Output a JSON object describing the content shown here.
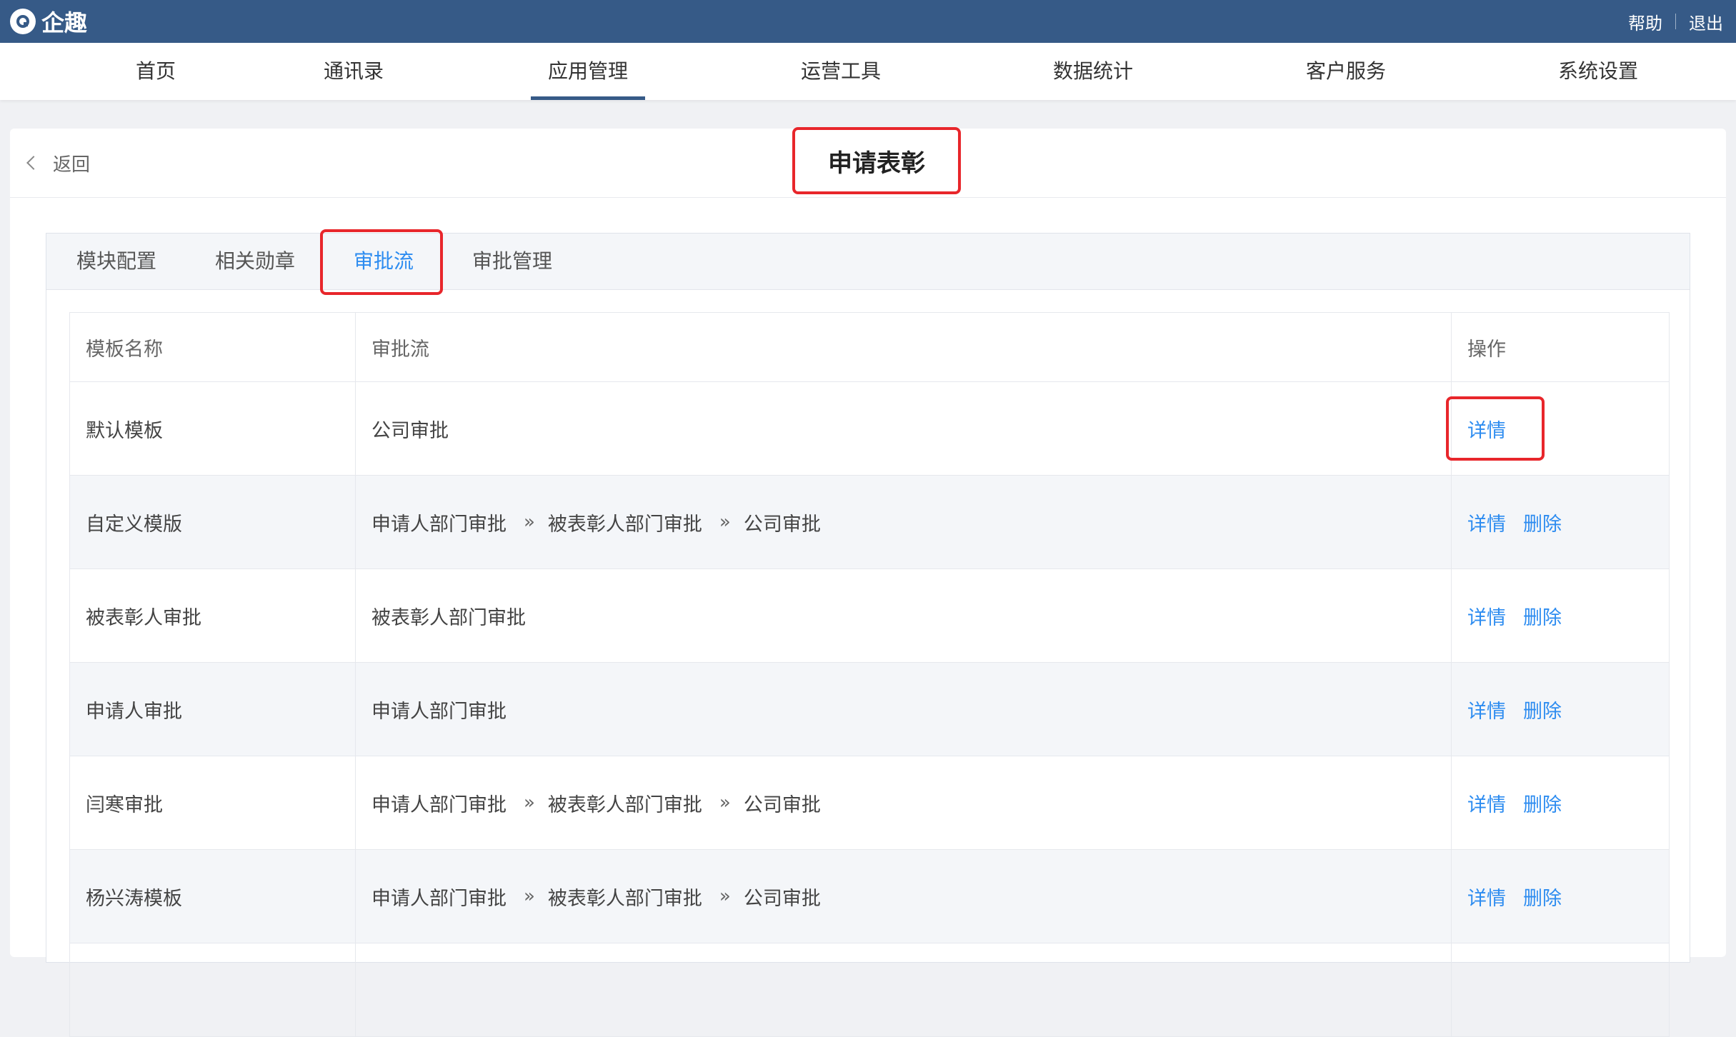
{
  "brand": {
    "logo_text": "企趣"
  },
  "top_links": {
    "help": "帮助",
    "logout": "退出"
  },
  "nav": [
    {
      "label": "首页"
    },
    {
      "label": "通讯录"
    },
    {
      "label": "应用管理",
      "active": true
    },
    {
      "label": "运营工具"
    },
    {
      "label": "数据统计"
    },
    {
      "label": "客户服务"
    },
    {
      "label": "系统设置"
    }
  ],
  "page": {
    "back_label": "返回",
    "title": "申请表彰"
  },
  "tabs": [
    {
      "label": "模块配置"
    },
    {
      "label": "相关勋章"
    },
    {
      "label": "审批流",
      "active": true
    },
    {
      "label": "审批管理"
    }
  ],
  "table": {
    "headers": {
      "name": "模板名称",
      "flow": "审批流",
      "action": "操作"
    },
    "rows": [
      {
        "name": "默认模板",
        "flow": [
          "公司审批"
        ],
        "actions": [
          "详情"
        ]
      },
      {
        "name": "自定义模版",
        "flow": [
          "申请人部门审批",
          "被表彰人部门审批",
          "公司审批"
        ],
        "actions": [
          "详情",
          "删除"
        ]
      },
      {
        "name": "被表彰人审批",
        "flow": [
          "被表彰人部门审批"
        ],
        "actions": [
          "详情",
          "删除"
        ]
      },
      {
        "name": "申请人审批",
        "flow": [
          "申请人部门审批"
        ],
        "actions": [
          "详情",
          "删除"
        ]
      },
      {
        "name": "闫寒审批",
        "flow": [
          "申请人部门审批",
          "被表彰人部门审批",
          "公司审批"
        ],
        "actions": [
          "详情",
          "删除"
        ]
      },
      {
        "name": "杨兴涛模板",
        "flow": [
          "申请人部门审批",
          "被表彰人部门审批",
          "公司审批"
        ],
        "actions": [
          "详情",
          "删除"
        ]
      }
    ]
  },
  "colors": {
    "topbar": "#365a87",
    "link": "#2d8cf0",
    "highlight": "#e8262b"
  }
}
